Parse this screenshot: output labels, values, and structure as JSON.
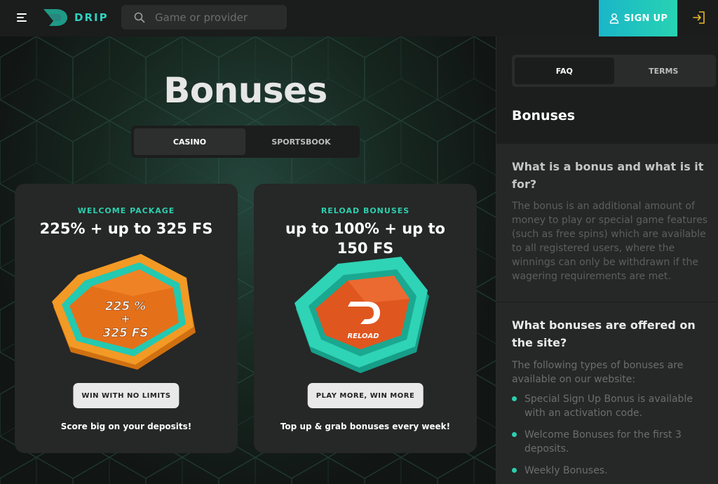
{
  "header": {
    "brand": "DRIP",
    "search_placeholder": "Game or provider",
    "signup_label": "SIGN UP"
  },
  "hero": {
    "title": "Bonuses",
    "tabs": [
      {
        "label": "CASINO",
        "active": true
      },
      {
        "label": "SPORTSBOOK",
        "active": false
      }
    ]
  },
  "cards": [
    {
      "kicker": "WELCOME PACKAGE",
      "headline": "225% + up to 325 FS",
      "art_text_1": "225 %",
      "art_text_2": "+",
      "art_text_3": "325 FS",
      "cta": "WIN WITH NO LIMITS",
      "foot": "Score big on your deposits!"
    },
    {
      "kicker": "RELOAD BONUSES",
      "headline": "up to 100% + up to 150 FS",
      "art_text_1": "RELOAD",
      "cta": "PLAY MORE, WIN MORE",
      "foot": "Top up & grab bonuses every week!"
    }
  ],
  "sidebar": {
    "tabs": [
      {
        "label": "FAQ",
        "active": true
      },
      {
        "label": "TERMS",
        "active": false
      }
    ],
    "heading": "Bonuses",
    "faq": [
      {
        "question": "What is a bonus and what is it for?",
        "answer": "The bonus is an additional amount of money to play or special game features (such as free spins) which are available to all registered users, where the winnings can only be withdrawn if the wagering requirements are met."
      },
      {
        "question": "What bonuses are offered on the site?",
        "answer": "The following types of bonuses are available on our website:",
        "list": [
          "Special Sign Up Bonus is available with an activation code.",
          "Welcome Bonuses for the first 3 deposits.",
          "Weekly Bonuses."
        ]
      }
    ]
  },
  "colors": {
    "accent": "#2ccfae",
    "signup_gradient_start": "#1ab6c9",
    "signup_gradient_end": "#27d3b2",
    "card_bg": "#262727",
    "welcome_orange": "#f08a1c",
    "reload_teal": "#2fd3b5"
  }
}
